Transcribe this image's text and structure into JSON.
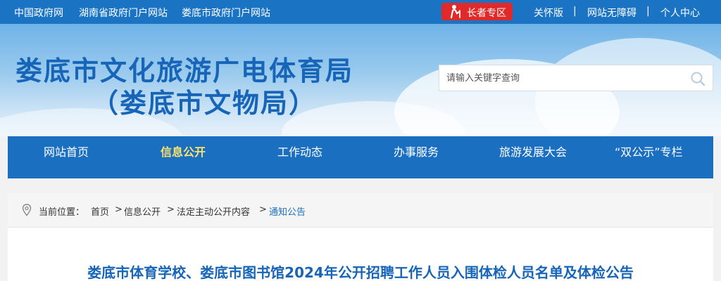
{
  "topbar": {
    "links": [
      "中国政府网",
      "湖南省政府门户网站",
      "娄底市政府门户网站"
    ],
    "elder_label": "长者专区",
    "right_links": [
      "关怀版",
      "网站无障碍",
      "个人中心"
    ],
    "separator": "|"
  },
  "banner": {
    "title": "娄底市文化旅游广电体育局",
    "subtitle": "（娄底市文物局）",
    "search_placeholder": "请输入关键字查询"
  },
  "nav": {
    "items": [
      {
        "label": "网站首页"
      },
      {
        "label": "信息公开"
      },
      {
        "label": "工作动态"
      },
      {
        "label": "办事服务"
      },
      {
        "label": "旅游发展大会"
      },
      {
        "label": "“双公示”专栏"
      }
    ],
    "active": "信息公开"
  },
  "breadcrumb": {
    "prefix": "当前位置：",
    "items": [
      "首页",
      "信息公开",
      "法定主动公开内容",
      "通知公告"
    ],
    "sep": ">"
  },
  "article": {
    "title": "娄底市体育学校、娄底市图书馆2024年公开招聘工作人员入围体检人员名单及体检公告"
  },
  "colors": {
    "topbar": "#1b73c4",
    "nav": "#1a6fc0",
    "title_blue": "#1665b8",
    "active_nav": "#ffe36b",
    "elder_red": "#e02a2a"
  }
}
